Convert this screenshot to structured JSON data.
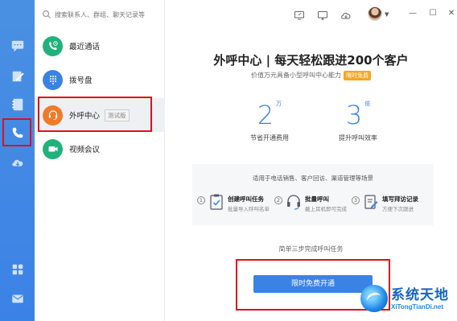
{
  "search": {
    "placeholder": "搜索联系人、群组、聊天记录等"
  },
  "sidebar": {
    "items": [
      {
        "label": "最近通话",
        "color": "#1fb27a",
        "icon": "phone-clock-icon"
      },
      {
        "label": "拨号盘",
        "color": "#3b82e6",
        "icon": "dialpad-icon"
      },
      {
        "label": "外呼中心",
        "color": "#f07a28",
        "icon": "headset-icon",
        "badge": "测试版"
      },
      {
        "label": "视频会议",
        "color": "#1fb27a",
        "icon": "video-icon"
      }
    ]
  },
  "main": {
    "headline": "外呼中心 | 每天轻松跟进200个客户",
    "subline": "价值万元具备小型呼叫中心能力",
    "subline_tag": "限时免费",
    "stats": [
      {
        "num": "2",
        "unit": "万",
        "caption": "节省开通费用"
      },
      {
        "num": "3",
        "unit": "倍",
        "caption": "提升呼叫效率"
      }
    ],
    "scenes": "适用于电话销售、客户回访、渠道管理等场景",
    "steps": [
      {
        "n": "1",
        "title": "创建呼叫任务",
        "desc": "批量导入呼叫名单"
      },
      {
        "n": "2",
        "title": "批量呼叫",
        "desc": "戴上耳机即可完成"
      },
      {
        "n": "3",
        "title": "填写拜访记录",
        "desc": "方便下次跟进"
      }
    ],
    "three_steps": "简单三步完成呼叫任务",
    "cta": "限时免费开通"
  },
  "watermark": {
    "cn": "系统天地",
    "en": "XiTongTianDi.net"
  },
  "colors": {
    "accent": "#3b82e6",
    "rail": "#4a90e2",
    "highlight": "#e0101a"
  }
}
